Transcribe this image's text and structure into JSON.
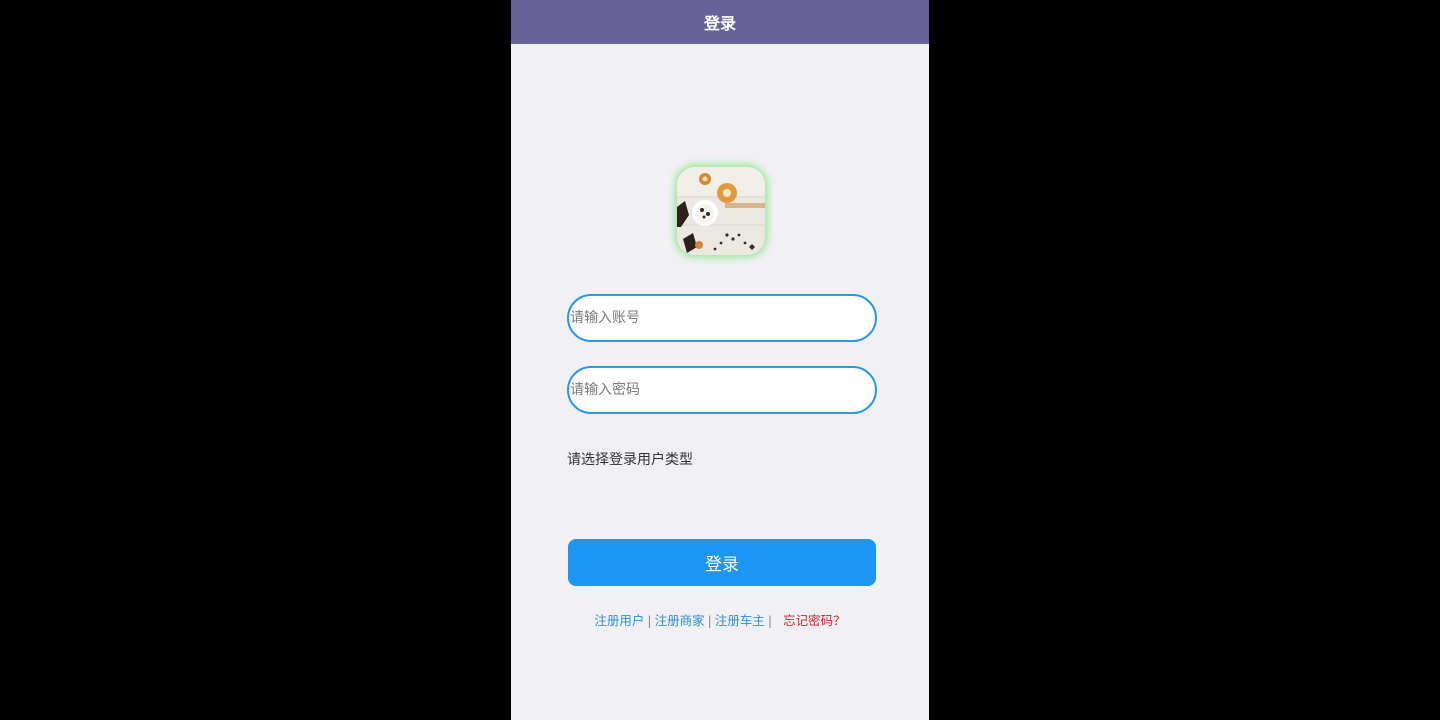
{
  "header": {
    "title": "登录"
  },
  "avatar": {
    "icon": "food-photo-avatar",
    "glow_color": "#8ee68a"
  },
  "form": {
    "account_placeholder": "请输入账号",
    "account_value": "",
    "password_placeholder": "请输入密码",
    "password_value": "",
    "user_type_label": "请选择登录用户类型",
    "login_button": "登录"
  },
  "footer_links": {
    "register_user": "注册用户",
    "register_merchant": "注册商家",
    "register_owner": "注册车主",
    "forgot_password": "忘记密码？",
    "separator": "|"
  },
  "colors": {
    "header_bg": "#67639a",
    "accent": "#1b96f2",
    "input_border": "#2d98e0",
    "link": "#2f8fd6",
    "warning_link": "#d3212d",
    "page_bg": "#f1f0f4"
  }
}
